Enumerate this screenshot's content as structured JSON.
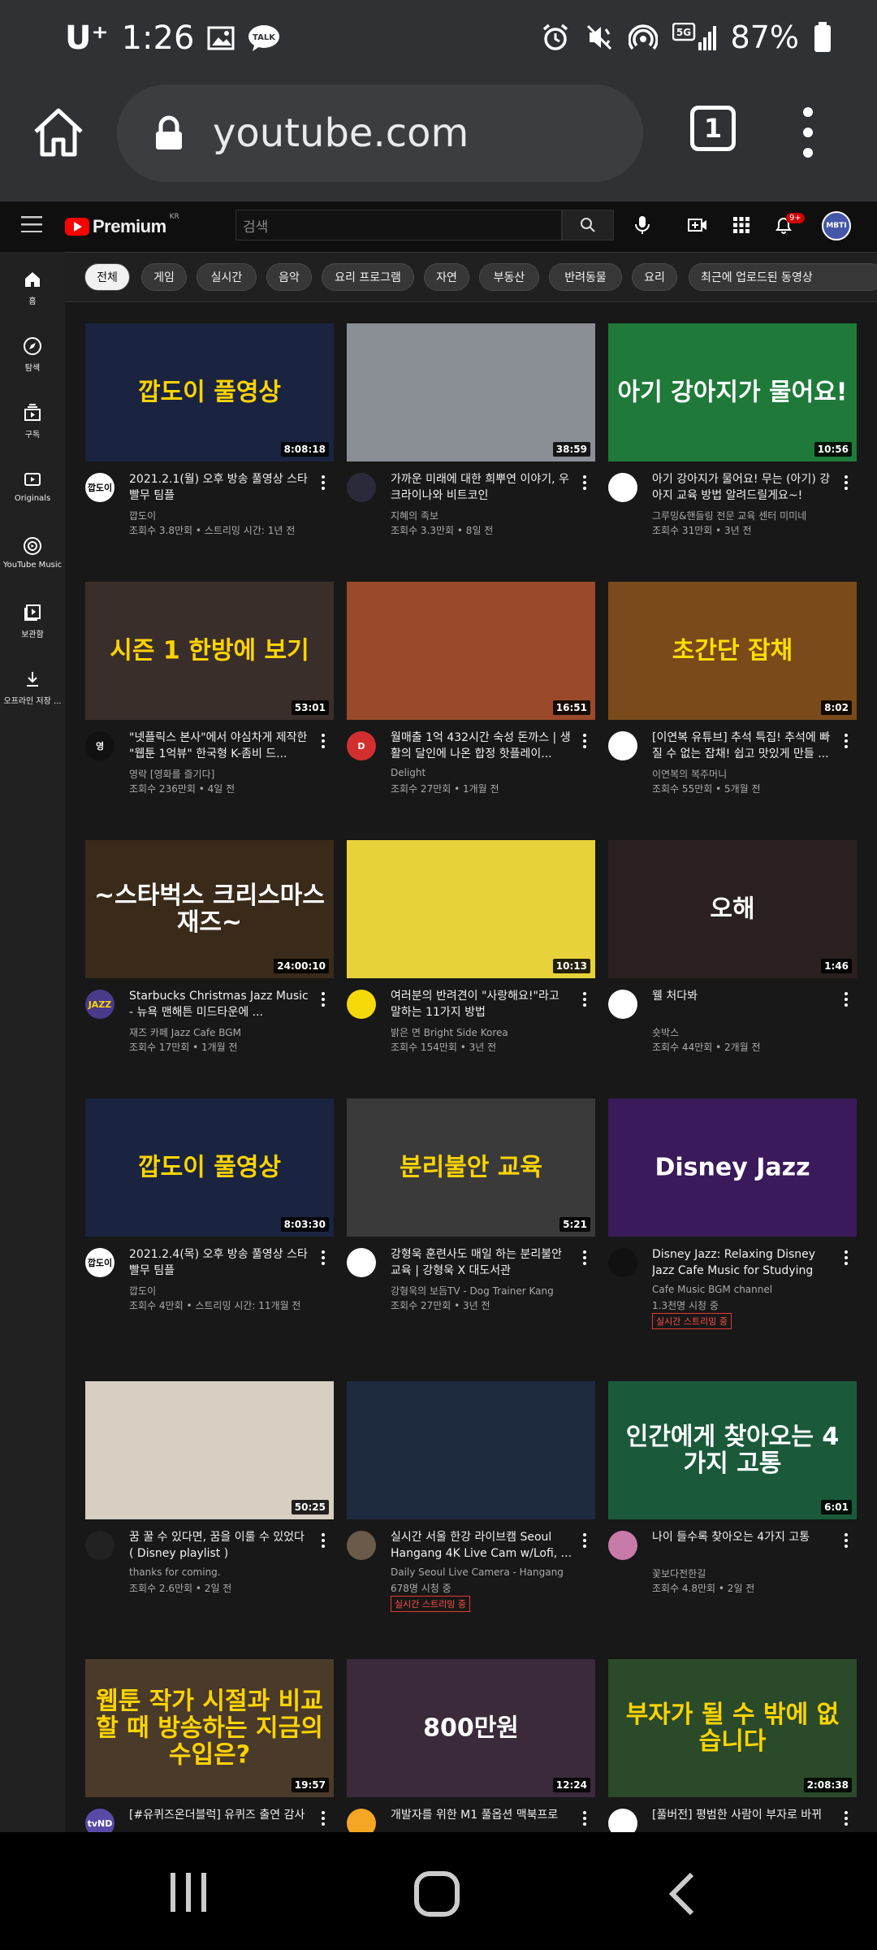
{
  "status": {
    "carrier": "U⁺",
    "time": "1:26",
    "battery": "87%"
  },
  "browser": {
    "url": "youtube.com",
    "tab_count": "1"
  },
  "header": {
    "logo_word": "Premium",
    "logo_region": "KR",
    "search_placeholder": "검색",
    "notification_count": "9+",
    "avatar_text": "MBTI"
  },
  "guide": [
    {
      "label": "홈",
      "icon": "home-icon"
    },
    {
      "label": "탐색",
      "icon": "compass-icon"
    },
    {
      "label": "구독",
      "icon": "subscriptions-icon"
    },
    {
      "label": "Originals",
      "icon": "originals-icon"
    },
    {
      "label": "YouTube Music",
      "icon": "music-icon"
    },
    {
      "label": "보관함",
      "icon": "library-icon"
    },
    {
      "label": "오프라인 저장 ...",
      "icon": "download-icon"
    }
  ],
  "chips": [
    "전체",
    "게임",
    "실시간",
    "음악",
    "요리 프로그램",
    "자연",
    "부동산",
    "반려동물",
    "요리",
    "최근에 업로드된 동영상"
  ],
  "videos": [
    {
      "thumb_text": "깝도이 풀영상",
      "thumb_color": "#1a2440",
      "text_color": "#ffd400",
      "duration": "8:08:18",
      "title": "2021.2.1(월) 오후 방송 풀영상 스타 빨무 팀플",
      "channel": "깝도이",
      "meta": "조회수 3.8만회 • 스트리밍 시간: 1년 전",
      "avatar_color": "#ffffff",
      "avatar_text": "깝도이",
      "avatar_text_color": "#000000",
      "live": ""
    },
    {
      "thumb_text": "",
      "thumb_color": "#8a8f95",
      "text_color": "#ffffff",
      "duration": "38:59",
      "title": "가까운 미래에 대한 희뿌연 이야기, 우크라이나와 비트코인",
      "channel": "지혜의 족보",
      "meta": "조회수 3.3만회 • 8일 전",
      "avatar_color": "#2a2a3a",
      "avatar_text": "",
      "avatar_text_color": "#ffffff",
      "live": ""
    },
    {
      "thumb_text": "아기 강아지가 물어요!",
      "thumb_color": "#1f7a3a",
      "text_color": "#ffffff",
      "duration": "10:56",
      "title": "아기 강아지가 물어요! 무는 (아기) 강아지 교육 방법 알려드릴게요~!",
      "channel": "그루밍&핸들링 전문 교육 센터 미미네",
      "meta": "조회수 31만회 • 3년 전",
      "avatar_color": "#ffffff",
      "avatar_text": "",
      "avatar_text_color": "#000000",
      "live": ""
    },
    {
      "thumb_text": "시즌 1 한방에 보기",
      "thumb_color": "#3a2e2a",
      "text_color": "#ffd400",
      "duration": "53:01",
      "title": "\"넷플릭스 본사\"에서 야심차게 제작한 \"웹툰 1억뷰\" 한국형 K-좀비 드...",
      "channel": "영락 [영화를 즐기다]",
      "meta": "조회수 236만회 • 4일 전",
      "avatar_color": "#111111",
      "avatar_text": "영",
      "avatar_text_color": "#ffffff",
      "live": ""
    },
    {
      "thumb_text": "",
      "thumb_color": "#9a4a2a",
      "text_color": "#ffffff",
      "duration": "16:51",
      "title": "월매출 1억 432시간 숙성 돈까스 | 생활의 달인에 나온 합정 핫플레이...",
      "channel": "Delight",
      "meta": "조회수 27만회 • 1개월 전",
      "avatar_color": "#d32f2f",
      "avatar_text": "D",
      "avatar_text_color": "#ffffff",
      "live": ""
    },
    {
      "thumb_text": "초간단 잡채",
      "thumb_color": "#7a4a1a",
      "text_color": "#ffdd00",
      "duration": "8:02",
      "title": "[이연복 유튜브] 추석 특집! 추석에 빠질 수 없는 잡채! 쉽고 맛있게 만들 ...",
      "channel": "이연복의 복주머니",
      "meta": "조회수 55만회 • 5개월 전",
      "avatar_color": "#ffffff",
      "avatar_text": "",
      "avatar_text_color": "#000000",
      "live": ""
    },
    {
      "thumb_text": "~스타벅스 크리스마스 재즈~",
      "thumb_color": "#3a2a1a",
      "text_color": "#ffffff",
      "duration": "24:00:10",
      "title": "Starbucks Christmas Jazz Music - 뉴욕 맨해튼 미드타운에 ...",
      "channel": "재즈 카페 Jazz Cafe BGM",
      "meta": "조회수 17만회 • 1개월 전",
      "avatar_color": "#4a3a8a",
      "avatar_text": "JAZZ",
      "avatar_text_color": "#ffd400",
      "live": ""
    },
    {
      "thumb_text": "",
      "thumb_color": "#e8d23a",
      "text_color": "#ffffff",
      "duration": "10:13",
      "title": "여러분의 반려견이 \"사랑해요!\"라고 말하는 11가지 방법",
      "channel": "밝은 면 Bright Side Korea",
      "meta": "조회수 154만회 • 3년 전",
      "avatar_color": "#f5d90a",
      "avatar_text": "",
      "avatar_text_color": "#000000",
      "live": ""
    },
    {
      "thumb_text": "오해",
      "thumb_color": "#2a2020",
      "text_color": "#ffffff",
      "duration": "1:46",
      "title": "웰 처다봐",
      "channel": "숏박스",
      "meta": "조회수 44만회 • 2개월 전",
      "avatar_color": "#ffffff",
      "avatar_text": "",
      "avatar_text_color": "#000000",
      "live": ""
    },
    {
      "thumb_text": "깝도이 풀영상",
      "thumb_color": "#1a2440",
      "text_color": "#ffd400",
      "duration": "8:03:30",
      "title": "2021.2.4(목) 오후 방송 풀영상 스타 빨무 팀플",
      "channel": "깝도이",
      "meta": "조회수 4만회 • 스트리밍 시간: 11개월 전",
      "avatar_color": "#ffffff",
      "avatar_text": "깝도이",
      "avatar_text_color": "#000000",
      "live": ""
    },
    {
      "thumb_text": "분리불안 교육",
      "thumb_color": "#3a3a3a",
      "text_color": "#ffd400",
      "duration": "5:21",
      "title": "강형욱 훈련사도 매일 하는 분리불안 교육 | 강형욱 X 대도서관",
      "channel": "강형욱의 보듬TV - Dog Trainer Kang",
      "meta": "조회수 27만회 • 3년 전",
      "avatar_color": "#ffffff",
      "avatar_text": "",
      "avatar_text_color": "#000000",
      "live": ""
    },
    {
      "thumb_text": "Disney Jazz",
      "thumb_color": "#3a1a5a",
      "text_color": "#ffffff",
      "duration": "",
      "title": "Disney Jazz: Relaxing Disney Jazz Cafe Music for Studying",
      "channel": "Cafe Music BGM channel",
      "meta": "1.3천명 시청 중",
      "avatar_color": "#111111",
      "avatar_text": "",
      "avatar_text_color": "#ffffff",
      "live": "실시간 스트리밍 중"
    },
    {
      "thumb_text": "",
      "thumb_color": "#d6cfc2",
      "text_color": "#ffffff",
      "duration": "50:25",
      "title": "꿈 꿀 수 있다면, 꿈을 이룰 수 있었다 ( Disney playlist )",
      "channel": "thanks for coming.",
      "meta": "조회수 2.6만회 • 2일 전",
      "avatar_color": "#222222",
      "avatar_text": "",
      "avatar_text_color": "#ffffff",
      "live": ""
    },
    {
      "thumb_text": "",
      "thumb_color": "#1e2a40",
      "text_color": "#ffffff",
      "duration": "",
      "title": "실시간 서울 한강 라이브캠 Seoul Hangang 4K Live Cam w/Lofi, ...",
      "channel": "Daily Seoul Live Camera - Hangang",
      "meta": "678명 시청 중",
      "avatar_color": "#6a5a4a",
      "avatar_text": "",
      "avatar_text_color": "#ffffff",
      "live": "실시간 스트리밍 중"
    },
    {
      "thumb_text": "인간에게 찾아오는 4가지 고통",
      "thumb_color": "#1a5a3a",
      "text_color": "#ffffff",
      "duration": "6:01",
      "title": "나이 들수록 찾아오는 4가지 고통",
      "channel": "꽃보다전한길",
      "meta": "조회수 4.8만회 • 2일 전",
      "avatar_color": "#c87aa8",
      "avatar_text": "",
      "avatar_text_color": "#ffffff",
      "live": ""
    },
    {
      "thumb_text": "웹툰 작가 시절과 비교할 때 방송하는 지금의 수입은?",
      "thumb_color": "#4a3a2a",
      "text_color": "#ffd400",
      "duration": "19:57",
      "title": "[#유퀴즈온더블럭] 유퀴즈 출연 감사",
      "channel": "",
      "meta": "",
      "avatar_color": "#5a4aa8",
      "avatar_text": "tvND",
      "avatar_text_color": "#ffffff",
      "live": ""
    },
    {
      "thumb_text": "800만원",
      "thumb_color": "#3a2a3a",
      "text_color": "#ffffff",
      "duration": "12:24",
      "title": "개발자를 위한 M1 풀옵션 맥북프로",
      "channel": "",
      "meta": "",
      "avatar_color": "#f5a623",
      "avatar_text": "",
      "avatar_text_color": "#ffffff",
      "live": ""
    },
    {
      "thumb_text": "부자가 될 수 밖에 없습니다",
      "thumb_color": "#2a4a2a",
      "text_color": "#ffd400",
      "duration": "2:08:38",
      "title": "[풀버전] 평범한 사람이 부자로 바뀌",
      "channel": "",
      "meta": "",
      "avatar_color": "#ffffff",
      "avatar_text": "",
      "avatar_text_color": "#000000",
      "live": ""
    }
  ]
}
